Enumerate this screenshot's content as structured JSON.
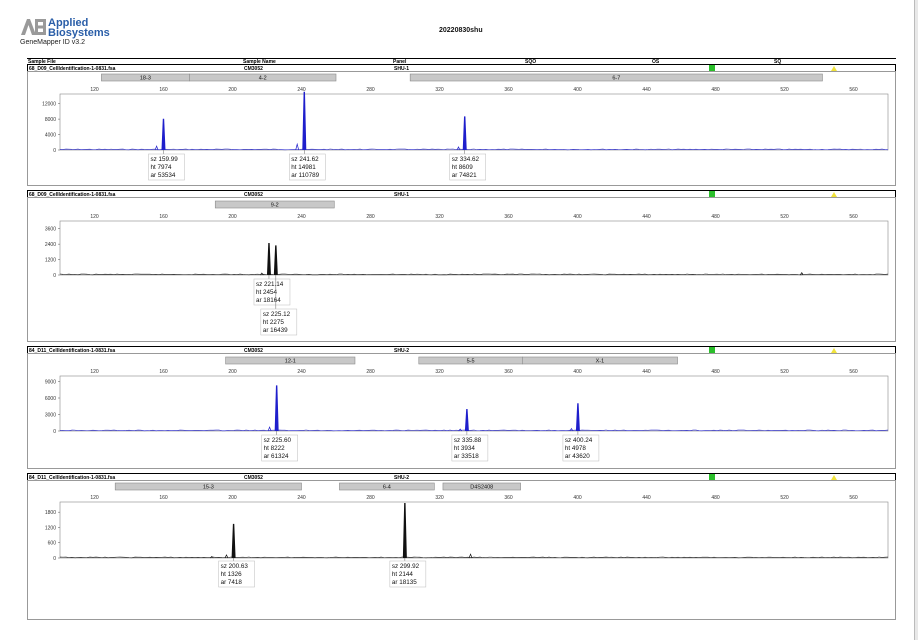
{
  "header": {
    "brand_line1": "Applied",
    "brand_line2": "Biosystems",
    "software": "GeneMapper ID v3.2",
    "title": "20220830shu",
    "columns": [
      "Sample File",
      "Sample Name",
      "Panel",
      "SQO",
      "OS",
      "SQ"
    ]
  },
  "colors": {
    "blue_trace": "#1f1fcc",
    "black_trace": "#111111",
    "bin_grey": "#c8c8c8",
    "pass": "#2bbf2b",
    "warn": "#f0e23a"
  },
  "chart_data": [
    {
      "type": "line",
      "sample_file": "68_D09_CellIdentification-1-0831.fsa",
      "sample_name": "CM3052",
      "panel": "SHU-1",
      "color": "blue",
      "xlim": [
        100,
        580
      ],
      "x_ticks": [
        120,
        160,
        200,
        240,
        280,
        320,
        360,
        400,
        440,
        480,
        520,
        560
      ],
      "ylim": [
        0,
        14500
      ],
      "y_ticks": [
        0,
        4000,
        8000,
        12000
      ],
      "bins": [
        {
          "label": "18-3",
          "from": 124,
          "to": 175
        },
        {
          "label": "4-2",
          "from": 175,
          "to": 260
        },
        {
          "label": "6-7",
          "from": 303,
          "to": 542
        }
      ],
      "peaks": [
        {
          "x": 159.99,
          "y": 7974,
          "sz": "sz 159.99",
          "ht": "ht 7974",
          "ar": "ar 53534"
        },
        {
          "x": 241.62,
          "y": 14981,
          "sz": "sz 241.62",
          "ht": "ht 14981",
          "ar": "ar 110789"
        },
        {
          "x": 334.62,
          "y": 8609,
          "sz": "sz 334.62",
          "ht": "ht 8609",
          "ar": "ar 74821"
        }
      ],
      "minor_peaks": [
        {
          "x": 156,
          "y": 1000
        },
        {
          "x": 237.5,
          "y": 1500
        },
        {
          "x": 331,
          "y": 800
        }
      ]
    },
    {
      "type": "line",
      "sample_file": "68_D09_CellIdentification-1-0831.fsa",
      "sample_name": "CM3052",
      "panel": "SHU-1",
      "color": "black",
      "xlim": [
        100,
        580
      ],
      "x_ticks": [
        120,
        160,
        200,
        240,
        280,
        320,
        360,
        400,
        440,
        480,
        520,
        560
      ],
      "ylim": [
        0,
        4200
      ],
      "y_ticks": [
        0,
        1200,
        2400,
        3600
      ],
      "bins": [
        {
          "label": "9-2",
          "from": 190,
          "to": 259
        }
      ],
      "peaks": [
        {
          "x": 221.14,
          "y": 2454,
          "sz": "sz 221.14",
          "ht": "ht 2454",
          "ar": "ar 18164"
        },
        {
          "x": 225.12,
          "y": 2275,
          "sz": "sz 225.12",
          "ht": "ht 2275",
          "ar": "ar 16439"
        }
      ],
      "minor_peaks": [
        {
          "x": 217,
          "y": 150
        },
        {
          "x": 530,
          "y": 180
        }
      ]
    },
    {
      "type": "line",
      "sample_file": "84_D11_CellIdentification-1-0831.fsa",
      "sample_name": "CM3052",
      "panel": "SHU-2",
      "color": "blue",
      "xlim": [
        100,
        580
      ],
      "x_ticks": [
        120,
        160,
        200,
        240,
        280,
        320,
        360,
        400,
        440,
        480,
        520,
        560
      ],
      "ylim": [
        0,
        10000
      ],
      "y_ticks": [
        0,
        3000,
        6000,
        9000
      ],
      "bins": [
        {
          "label": "12-1",
          "from": 196,
          "to": 271
        },
        {
          "label": "5-5",
          "from": 308,
          "to": 368
        },
        {
          "label": "X-1",
          "from": 368,
          "to": 458
        }
      ],
      "peaks": [
        {
          "x": 225.6,
          "y": 8222,
          "sz": "sz 225.60",
          "ht": "ht 8222",
          "ar": "ar 61324"
        },
        {
          "x": 335.88,
          "y": 3934,
          "sz": "sz 335.88",
          "ht": "ht 3934",
          "ar": "ar 33518"
        },
        {
          "x": 400.24,
          "y": 4978,
          "sz": "sz 400.24",
          "ht": "ht 4978",
          "ar": "ar 43620"
        }
      ],
      "minor_peaks": [
        {
          "x": 221.5,
          "y": 700
        },
        {
          "x": 332,
          "y": 350
        },
        {
          "x": 396.5,
          "y": 450
        }
      ]
    },
    {
      "type": "line",
      "sample_file": "84_D11_CellIdentification-1-0831.fsa",
      "sample_name": "CM3052",
      "panel": "SHU-2",
      "color": "black",
      "xlim": [
        100,
        580
      ],
      "x_ticks": [
        120,
        160,
        200,
        240,
        280,
        320,
        360,
        400,
        440,
        480,
        520,
        560
      ],
      "ylim": [
        0,
        2200
      ],
      "y_ticks": [
        0,
        600,
        1200,
        1800
      ],
      "bins": [
        {
          "label": "15-3",
          "from": 132,
          "to": 240
        },
        {
          "label": "6-4",
          "from": 262,
          "to": 317
        },
        {
          "label": "D4S2408",
          "from": 322,
          "to": 367
        }
      ],
      "peaks": [
        {
          "x": 200.63,
          "y": 1326,
          "sz": "sz 200.63",
          "ht": "ht 1326",
          "ar": "ar 7418"
        },
        {
          "x": 299.92,
          "y": 2144,
          "sz": "sz 299.92",
          "ht": "ht 2144",
          "ar": "ar 18135"
        }
      ],
      "minor_peaks": [
        {
          "x": 196.5,
          "y": 120
        },
        {
          "x": 188,
          "y": 60
        },
        {
          "x": 338,
          "y": 150
        }
      ]
    }
  ]
}
